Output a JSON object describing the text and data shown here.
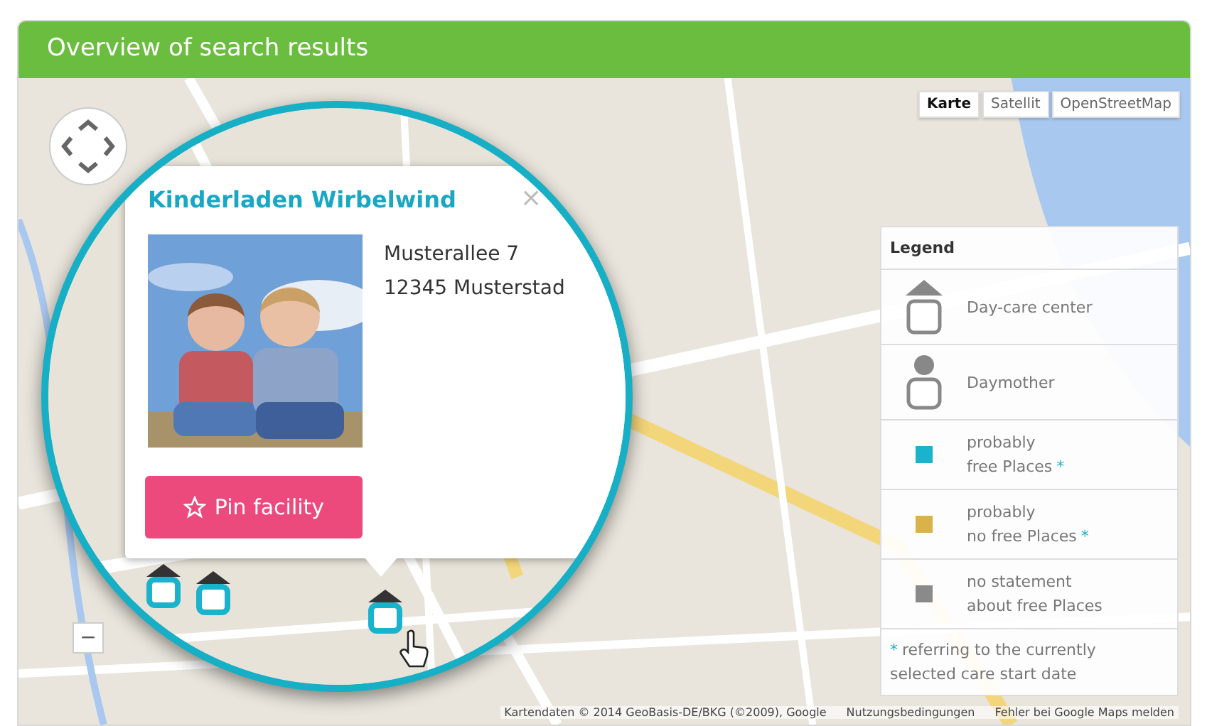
{
  "header": {
    "title": "Overview of search results"
  },
  "map_types": [
    {
      "label": "Karte",
      "selected": true
    },
    {
      "label": "Satellit",
      "selected": false
    },
    {
      "label": "OpenStreetMap",
      "selected": false
    }
  ],
  "zoom_out": {
    "label": "−"
  },
  "popup": {
    "title": "Kinderladen Wirbelwind",
    "close": "×",
    "address": "Musterallee 7\n12345 Musterstad",
    "button": {
      "label": "Pin facility"
    }
  },
  "legend": {
    "title": "Legend",
    "items": [
      {
        "kind": "house",
        "text": "Day-care center"
      },
      {
        "kind": "person",
        "text": "Daymother"
      },
      {
        "kind": "square",
        "color": "#19b3cc",
        "text": "probably\nfree Places",
        "mark": "*"
      },
      {
        "kind": "square",
        "color": "#d9b24a",
        "text": "probably\nno free Places",
        "mark": "*"
      },
      {
        "kind": "square",
        "color": "#8a8a8a",
        "text": "no statement\nabout free Places"
      }
    ],
    "footnote": {
      "mark": "*",
      "text": "referring to the currently\nselected care start date"
    }
  },
  "attribution": [
    "Kartendaten © 2014 GeoBasis-DE/BKG (©2009), Google",
    "Nutzungsbedingungen",
    "Fehler bei Google Maps melden"
  ]
}
